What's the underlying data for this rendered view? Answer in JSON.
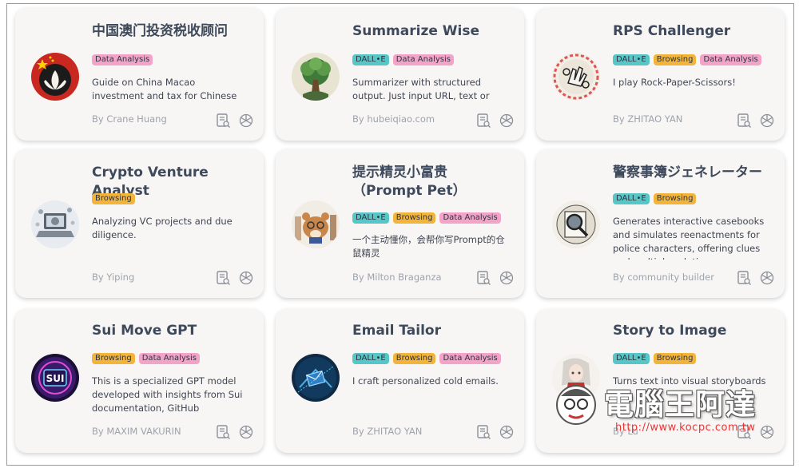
{
  "colors": {
    "dalle_tag": "#56c6c6",
    "browsing_tag": "#f2b43b",
    "data_tag": "#f3a3c8",
    "card_bg": "#f8f6f5",
    "title": "#3e4a5c",
    "author": "#9da3ab"
  },
  "cards": [
    {
      "title": "中国澳门投资税收顾问",
      "tags": [
        "Data Analysis"
      ],
      "description": "Guide on China Macao investment and tax for Chinese investors.",
      "author": "By Crane Huang",
      "avatar_icon": "lotus-flag-icon"
    },
    {
      "title": "Summarize Wise",
      "tags": [
        "DALL•E",
        "Data Analysis"
      ],
      "description": "Summarizer with structured output. Just input URL, text or upload files!",
      "author": "By hubeiqiao.com",
      "avatar_icon": "tree-icon"
    },
    {
      "title": "RPS Challenger",
      "tags": [
        "DALL•E",
        "Browsing",
        "Data Analysis"
      ],
      "description": "I play Rock-Paper-Scissors!",
      "author": "By ZHITAO YAN",
      "avatar_icon": "hand-scissors-icon"
    },
    {
      "title": "Crypto Venture Analyst",
      "tags": [
        "Browsing"
      ],
      "description": "Analyzing VC projects and due diligence.",
      "author": "By Yiping",
      "avatar_icon": "laptop-bitcoin-icon"
    },
    {
      "title": "提示精灵小富贵（Prompt Pet）",
      "tags": [
        "DALL•E",
        "Browsing",
        "Data Analysis"
      ],
      "description": "一个主动懂你，会帮你写Prompt的仓鼠精灵",
      "author": "By Milton Braganza",
      "avatar_icon": "hamster-icon"
    },
    {
      "title": "警察事簿ジェネレーター",
      "tags": [
        "DALL•E",
        "Browsing"
      ],
      "description": "Generates interactive casebooks and simulates reenactments for police characters, offering clues and multiple solutions.",
      "author": "By community builder",
      "avatar_icon": "magnifier-icon"
    },
    {
      "title": "Sui Move GPT",
      "tags": [
        "Browsing",
        "Data Analysis"
      ],
      "description": "This is a specialized GPT model developed with insights from Sui documentation, GitHub repositorie...",
      "author": "By MAXIM VAKURIN",
      "avatar_icon": "sui-logo-icon"
    },
    {
      "title": "Email Tailor",
      "tags": [
        "DALL•E",
        "Browsing",
        "Data Analysis"
      ],
      "description": "I craft personalized cold emails.",
      "author": "By ZHITAO YAN",
      "avatar_icon": "envelope-cube-icon"
    },
    {
      "title": "Story to Image",
      "tags": [
        "DALL•E",
        "Browsing"
      ],
      "description": "Turns text into visual storyboards",
      "author": "By Lu",
      "avatar_icon": "anime-girl-icon"
    }
  ],
  "watermark": {
    "text": "電腦王阿達",
    "url": "http://www.kocpc.com.tw"
  }
}
